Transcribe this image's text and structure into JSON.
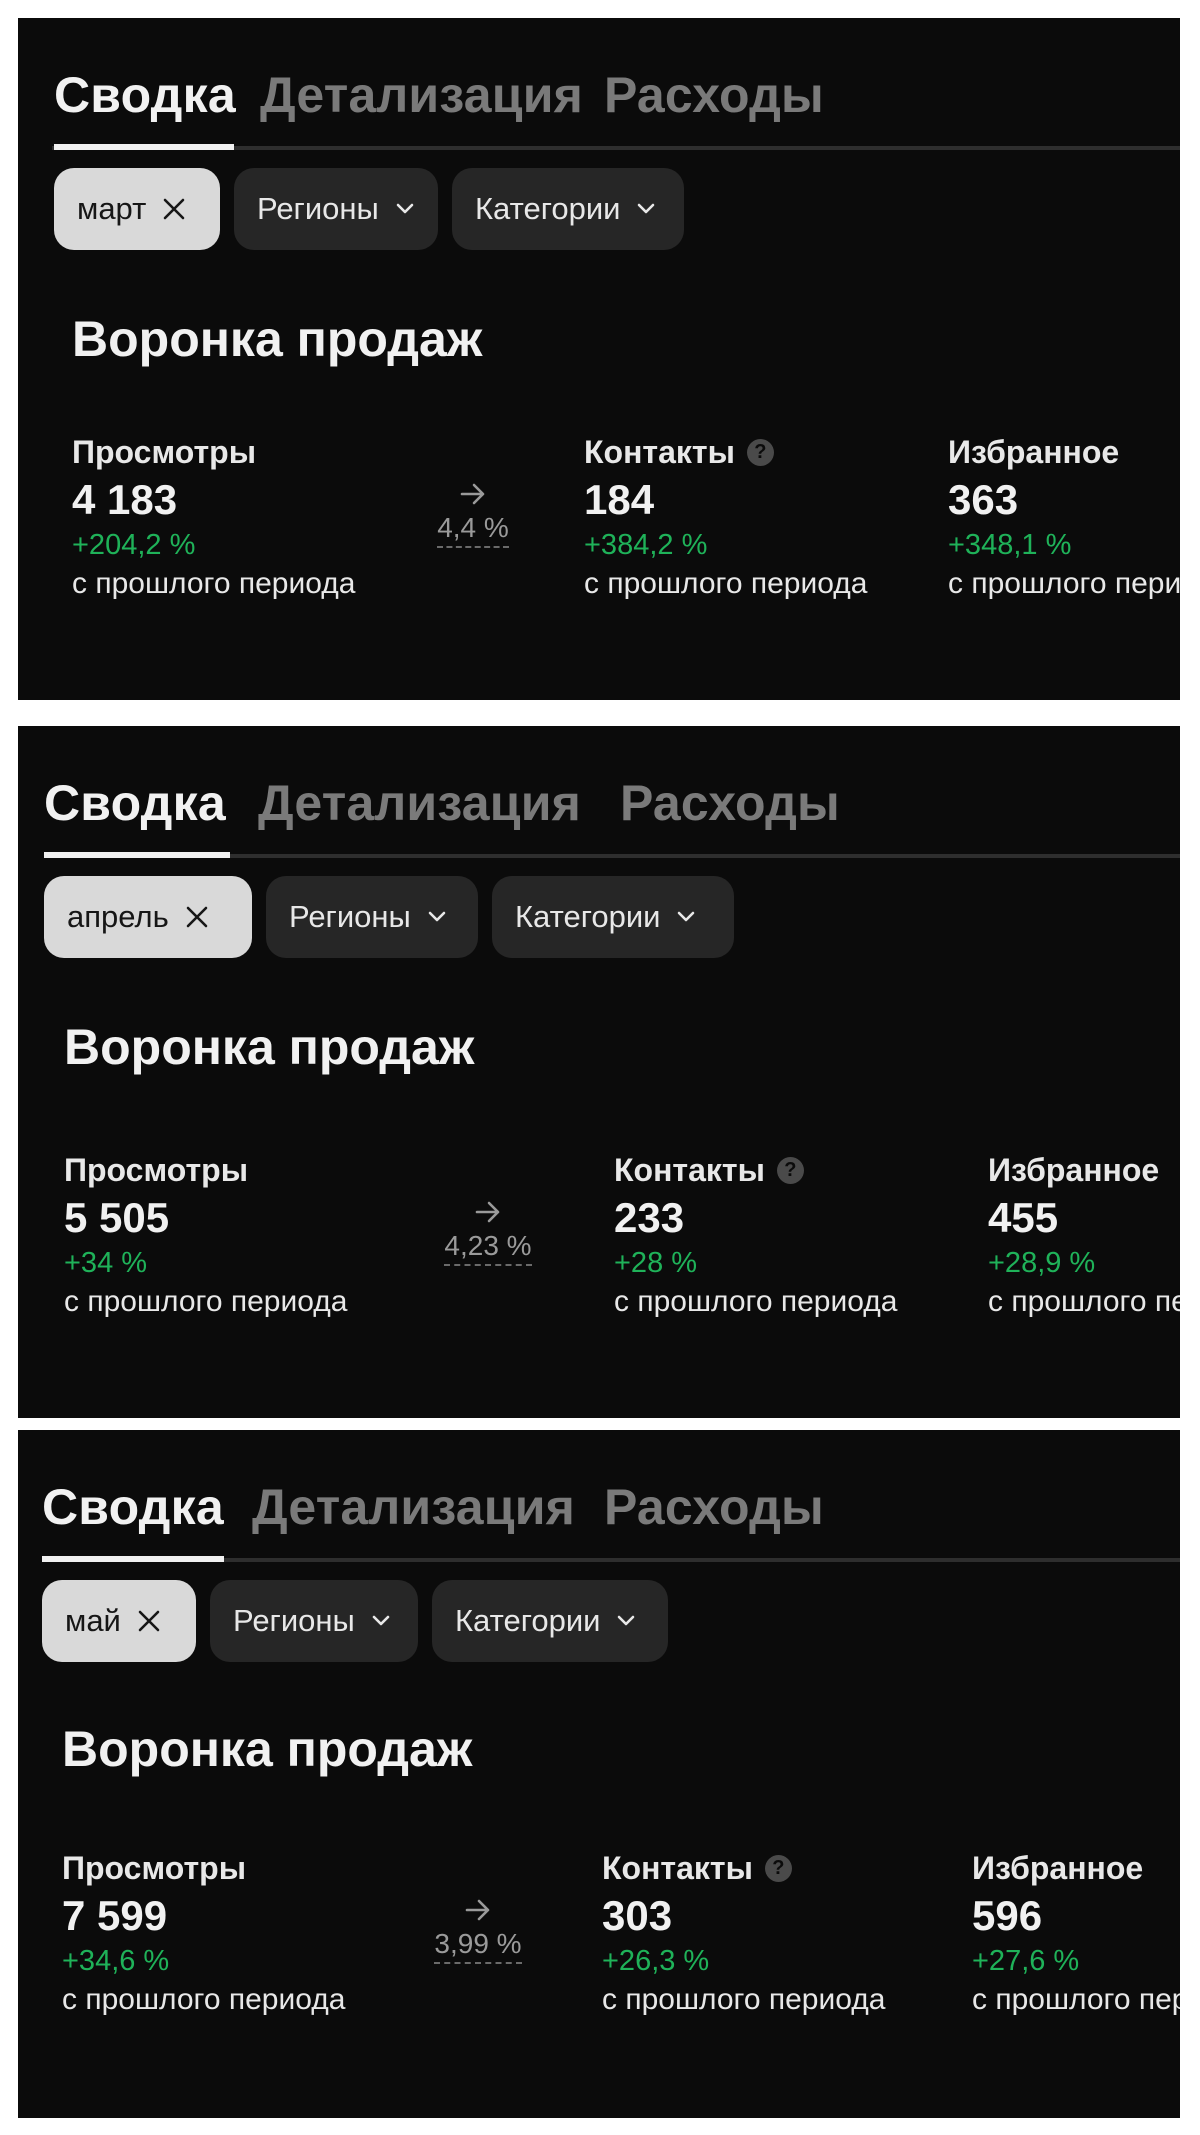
{
  "panels": [
    {
      "tabs": [
        "Сводка",
        "Детализация",
        "Расходы"
      ],
      "period_chip": "март",
      "regions_label": "Регионы",
      "categories_label": "Категории",
      "funnel_title": "Воронка продаж",
      "metrics": [
        {
          "label": "Просмотры",
          "value": "4 183",
          "change": "+204,2 %",
          "note": "с прошлого периода"
        },
        {
          "label": "Контакты",
          "value": "184",
          "change": "+384,2 %",
          "note": "с прошлого периода",
          "help": "?"
        },
        {
          "label": "Избранное",
          "value": "363",
          "change": "+348,1 %",
          "note": "с прошлого периода"
        }
      ],
      "conversion": "4,4 %"
    },
    {
      "tabs": [
        "Сводка",
        "Детализация",
        "Расходы"
      ],
      "period_chip": "апрель",
      "regions_label": "Регионы",
      "categories_label": "Категории",
      "funnel_title": "Воронка продаж",
      "metrics": [
        {
          "label": "Просмотры",
          "value": "5 505",
          "change": "+34 %",
          "note": "с прошлого периода"
        },
        {
          "label": "Контакты",
          "value": "233",
          "change": "+28 %",
          "note": "с прошлого периода",
          "help": "?"
        },
        {
          "label": "Избранное",
          "value": "455",
          "change": "+28,9 %",
          "note": "с прошлого периода"
        }
      ],
      "conversion": "4,23 %"
    },
    {
      "tabs": [
        "Сводка",
        "Детализация",
        "Расходы"
      ],
      "period_chip": "май",
      "regions_label": "Регионы",
      "categories_label": "Категории",
      "funnel_title": "Воронка продаж",
      "metrics": [
        {
          "label": "Просмотры",
          "value": "7 599",
          "change": "+34,6 %",
          "note": "с прошлого периода"
        },
        {
          "label": "Контакты",
          "value": "303",
          "change": "+26,3 %",
          "note": "с прошлого периода",
          "help": "?"
        },
        {
          "label": "Избранное",
          "value": "596",
          "change": "+27,6 %",
          "note": "с прошлого периода"
        }
      ],
      "conversion": "3,99 %"
    }
  ],
  "colors": {
    "panel_bg": "#0b0b0b",
    "positive_change": "#1fb259",
    "active_chip": "#d9d9d9",
    "inactive_tab": "#7a7a7a"
  },
  "icons": {
    "chip_close": "close-icon",
    "chip_dropdown": "chevron-down-icon",
    "conversion": "arrow-right-icon",
    "help": "question-circle-icon"
  }
}
